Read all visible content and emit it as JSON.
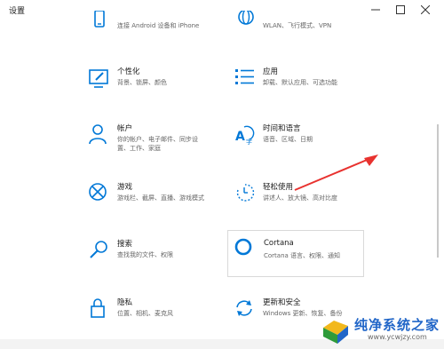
{
  "window": {
    "title": "设置"
  },
  "tiles": [
    {
      "title": "",
      "sub": "连接 Android 设备和 iPhone",
      "icon": "phone-icon"
    },
    {
      "title": "",
      "sub": "WLAN、飞行模式、VPN",
      "icon": "globe-icon"
    },
    {
      "title": "个性化",
      "sub": "背景、锁屏、颜色",
      "icon": "personalization-icon"
    },
    {
      "title": "应用",
      "sub": "卸载、默认应用、可选功能",
      "icon": "apps-icon"
    },
    {
      "title": "帐户",
      "sub1": "你的帐户、电子邮件、同步设",
      "sub2": "置、工作、家庭",
      "icon": "person-icon"
    },
    {
      "title": "时间和语言",
      "sub": "语音、区域、日期",
      "icon": "time-language-icon"
    },
    {
      "title": "游戏",
      "sub": "游戏栏、截屏、直播、游戏模式",
      "icon": "xbox-icon"
    },
    {
      "title": "轻松使用",
      "sub": "讲述人、放大镜、高对比度",
      "icon": "ease-of-access-icon"
    },
    {
      "title": "搜索",
      "sub": "查找我的文件、权限",
      "icon": "search-icon"
    },
    {
      "title": "Cortana",
      "sub": "Cortana 语言、权限、通知",
      "icon": "cortana-icon"
    },
    {
      "title": "隐私",
      "sub": "位置、相机、麦克风",
      "icon": "lock-icon"
    },
    {
      "title": "更新和安全",
      "sub": "Windows 更新、恢复、备份",
      "icon": "update-icon"
    }
  ],
  "watermark": {
    "name": "纯净系统之家",
    "url": "www.ycwjzy.com"
  },
  "colors": {
    "accent": "#0078d7",
    "arrow": "#e8322f"
  }
}
